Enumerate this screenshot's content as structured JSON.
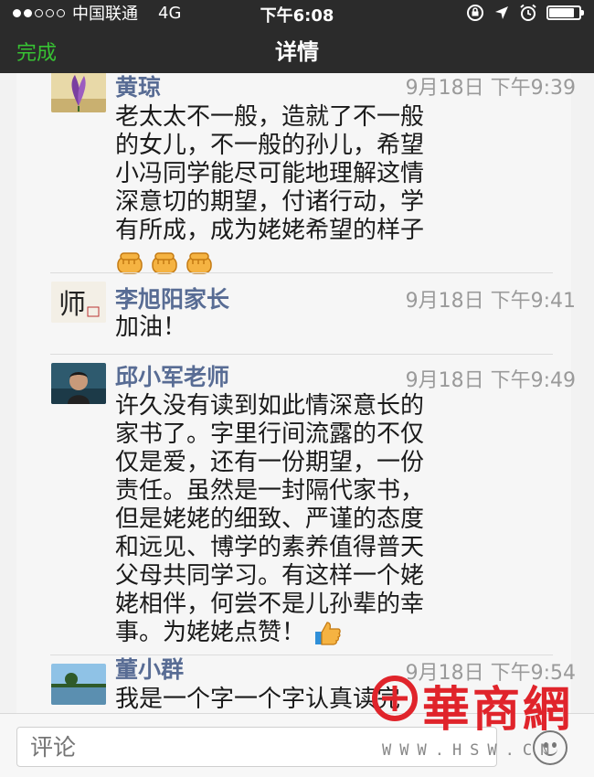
{
  "status_bar": {
    "carrier": "中国联通",
    "network": "4G",
    "time": "下午6:08"
  },
  "nav": {
    "done_label": "完成",
    "title": "详情"
  },
  "comments": [
    {
      "name": "黄琼",
      "timestamp": "9月18日  下午9:39",
      "lines": [
        "老太太不一般，造就了不一般",
        "的女儿，不一般的孙儿，希望",
        "小冯同学能尽可能地理解这情",
        "深意切的期望，付诸行动，学",
        "有所成，成为姥姥希望的样子"
      ],
      "emojis": [
        "fist",
        "fist",
        "fist"
      ]
    },
    {
      "name": "李旭阳家长",
      "timestamp": "9月18日  下午9:41",
      "lines": [
        "加油！"
      ],
      "avatar_text": "师"
    },
    {
      "name": "邱小军老师",
      "timestamp": "9月18日  下午9:49",
      "lines": [
        "许久没有读到如此情深意长的",
        "家书了。字里行间流露的不仅",
        "仅是爱，还有一份期望，一份",
        "责任。虽然是一封隔代家书，",
        "但是姥姥的细致、严谨的态度",
        "和远见、博学的素养值得普天",
        "父母共同学习。有这样一个姥",
        "姥相伴，何尝不是儿孙辈的幸",
        "事。为姥姥点赞！"
      ],
      "emojis": [
        "thumbs-up"
      ]
    },
    {
      "name": "董小群",
      "timestamp": "9月18日  下午9:54",
      "lines": [
        "我是一个字一个字认真读完"
      ]
    }
  ],
  "bottom_bar": {
    "comment_placeholder": "评论"
  },
  "watermark": {
    "text": "華商網",
    "url": "WWW.HSW.CN"
  },
  "colors": {
    "accent_green": "#37c233",
    "name_blue": "#586c94",
    "bar_dark": "#2b2b2b",
    "watermark_red": "#e0242b"
  }
}
